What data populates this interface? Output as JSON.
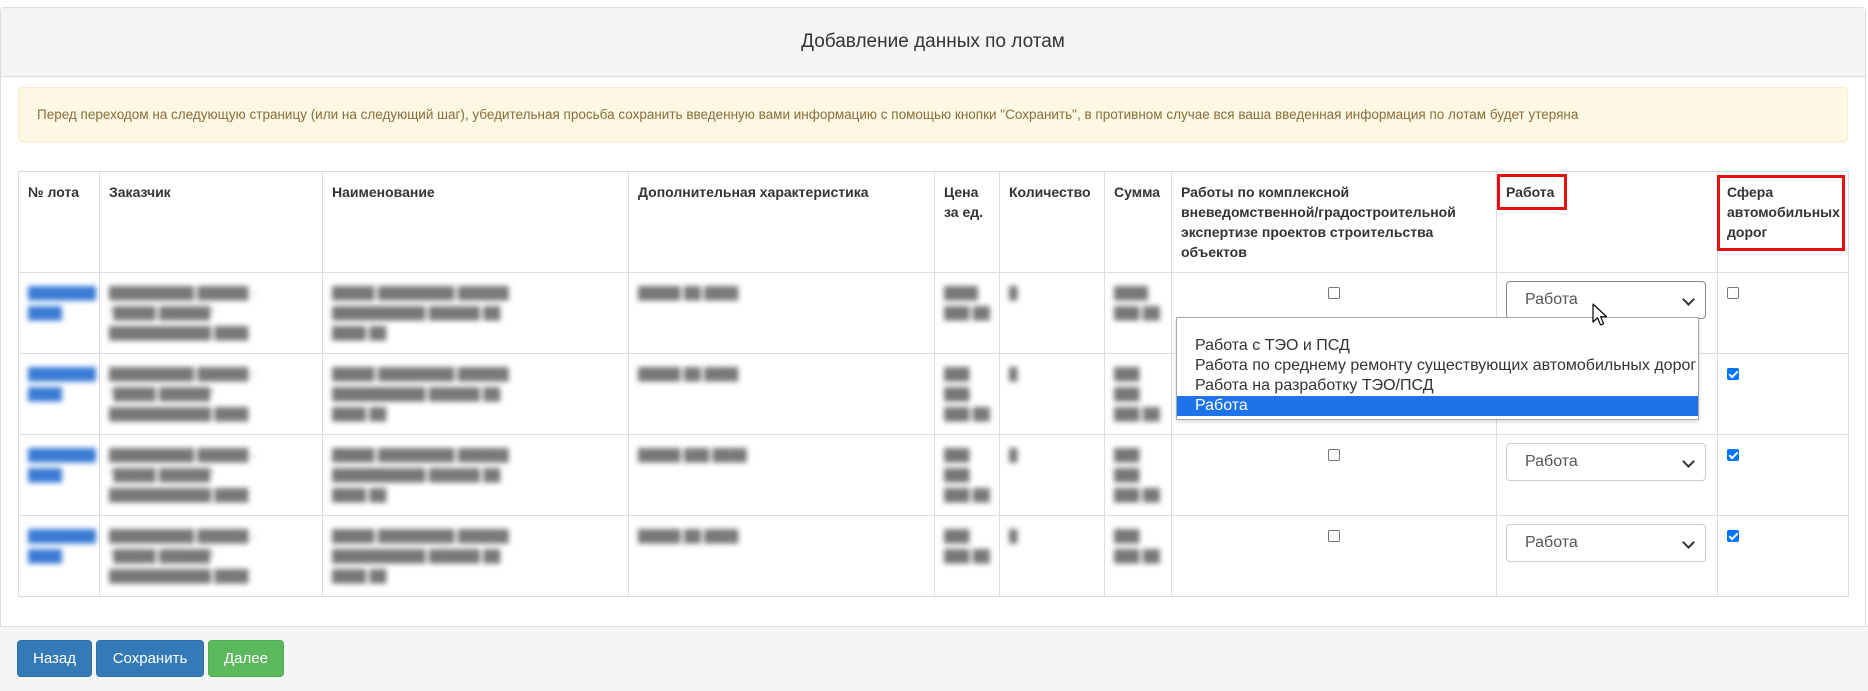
{
  "panel": {
    "title": "Добавление данных по лотам"
  },
  "alert": {
    "text": "Перед переходом на следующую страницу (или на следующий шаг), убедительная просьба сохранить введенную вами информацию с помощью кнопки \"Сохранить\", в противном случае вся ваша введенная информация по лотам будет утеряна"
  },
  "table": {
    "headers": [
      "№ лота",
      "Заказчик",
      "Наименование",
      "Дополнительная характеристика",
      "Цена за ед.",
      "Количество",
      "Сумма",
      "Работы по комплексной вневедомственной/градостроительной экспертизе проектов строительства объектов",
      "Работа",
      "Сфера автомобильных дорог"
    ],
    "rows": [
      {
        "expertise_checked": false,
        "work_type": "Работа",
        "road_checked": false
      },
      {
        "expertise_checked": false,
        "work_type": "Работа",
        "road_checked": true
      },
      {
        "expertise_checked": false,
        "work_type": "Работа",
        "road_checked": true
      },
      {
        "expertise_checked": false,
        "work_type": "Работа",
        "road_checked": true
      }
    ]
  },
  "dropdown": {
    "options": [
      "Работа с ТЭО и ПСД",
      "Работа по среднему ремонту существующих автомобильных дорог",
      "Работа на разработку ТЭО/ПСД",
      "Работа"
    ],
    "selected": "Работа"
  },
  "footer": {
    "back_label": "Назад",
    "save_label": "Сохранить",
    "next_label": "Далее"
  },
  "colors": {
    "primary": "#337ab7",
    "success": "#5cb85c",
    "highlight": "#e41010",
    "alert_bg": "#fcf8e3",
    "selected_option": "#1e73e8"
  }
}
